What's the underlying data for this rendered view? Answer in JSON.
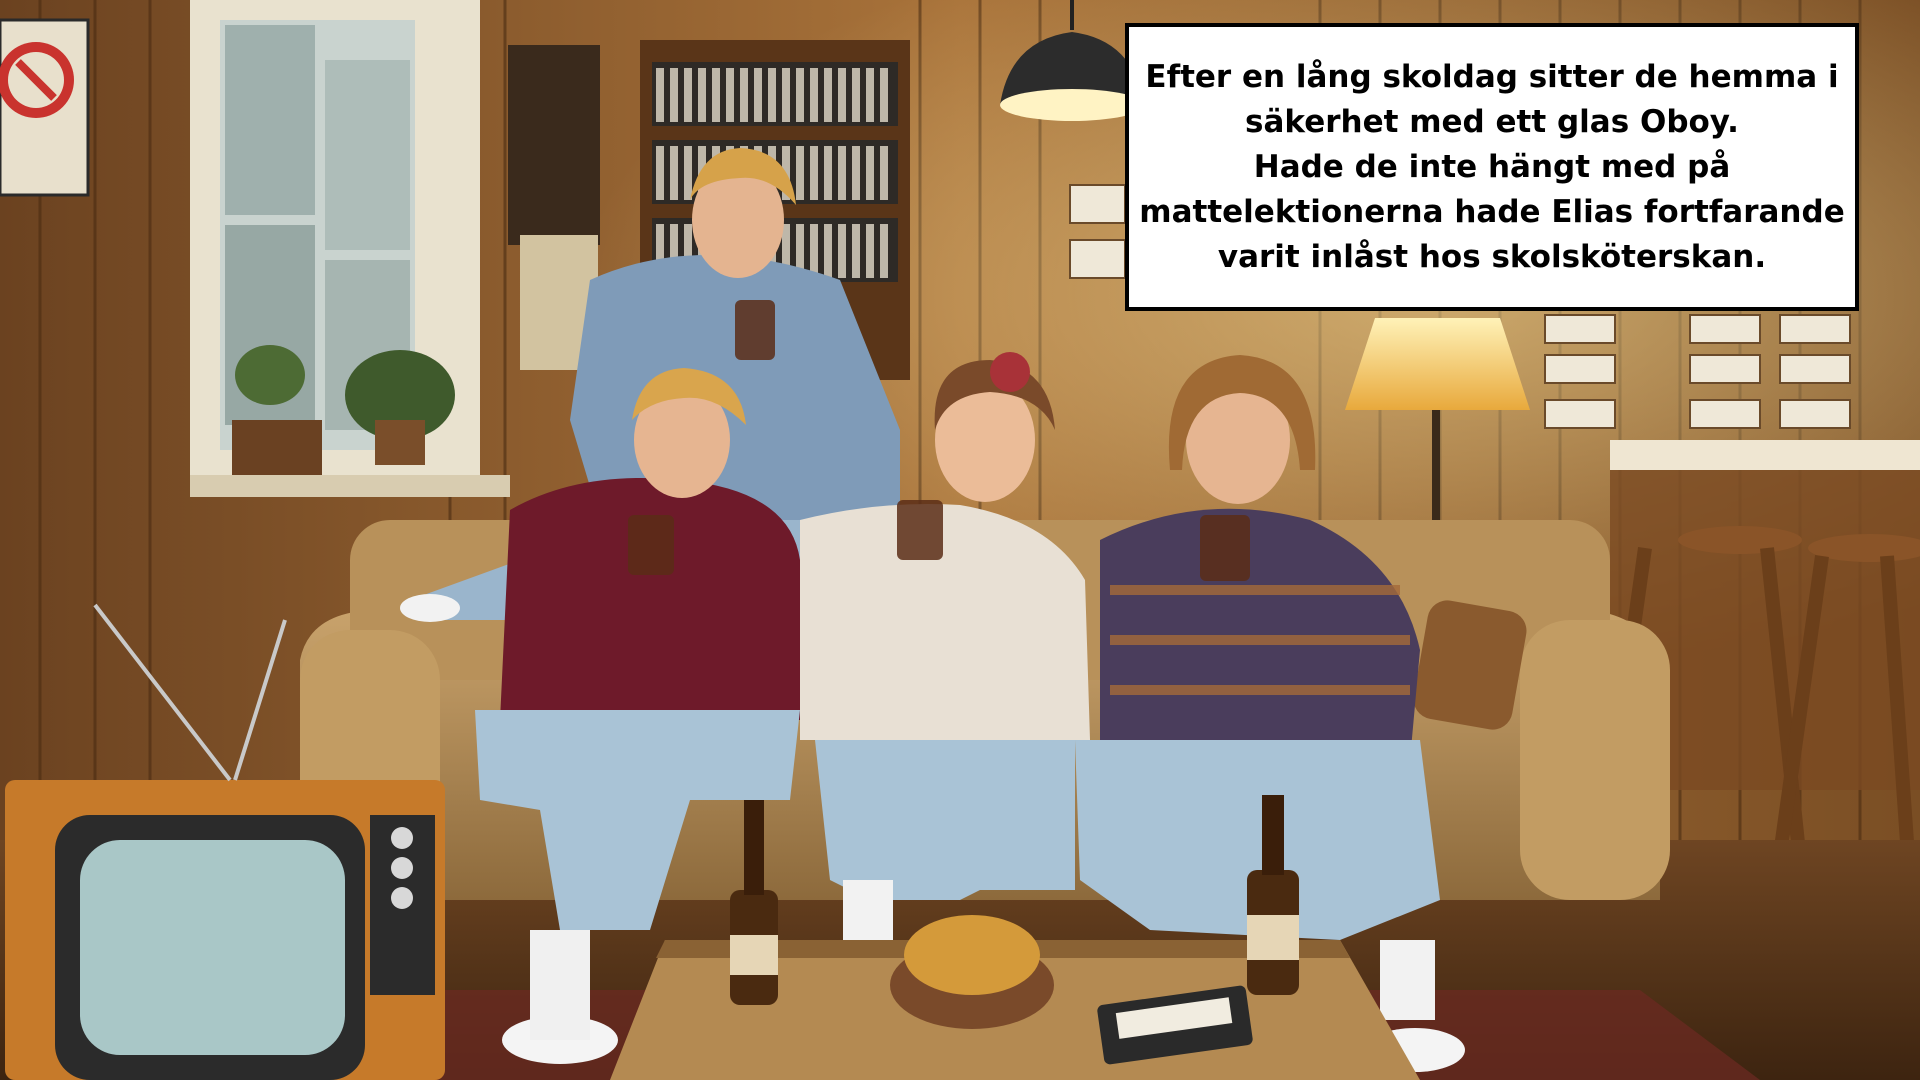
{
  "caption": {
    "lines": [
      "Efter en lång skoldag sitter de hemma i",
      "säkerhet med ett glas Oboy.",
      "Hade de inte hängt med på",
      "mattelektionerna hade Elias fortfarande",
      "varit inlåst hos skolsköterskan."
    ]
  },
  "scene": {
    "description_tags": [
      "wood-paneled-room",
      "couch",
      "four-teenagers",
      "crt-television",
      "coffee-table",
      "chips-bowl",
      "bottles",
      "cassette",
      "floor-lamp",
      "bar-stools",
      "cassette-shelf"
    ],
    "colors": {
      "wall_wood": "#8a5a2b",
      "wall_wood_light": "#b07a3c",
      "couch": "#b08a55",
      "floor": "#5a3a1e",
      "lamp_glow": "#f6d27a",
      "caption_bg": "#ffffff",
      "caption_border": "#000000"
    }
  }
}
